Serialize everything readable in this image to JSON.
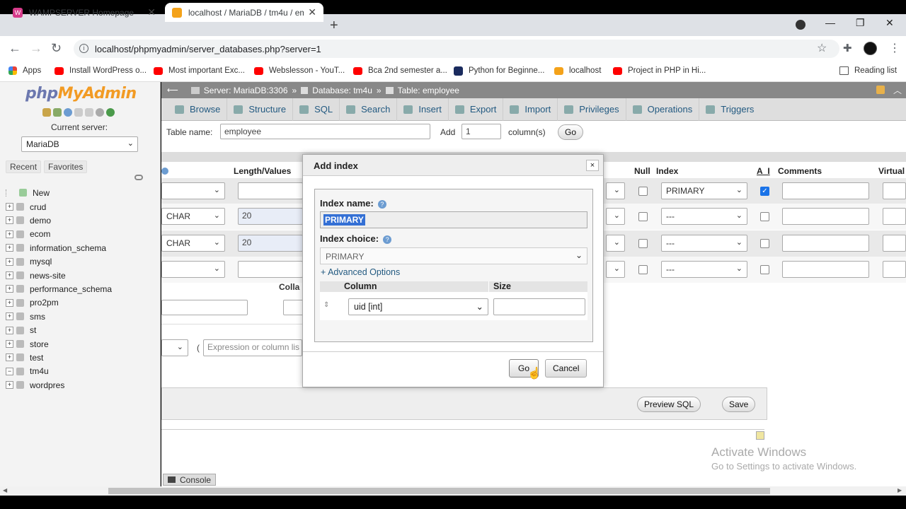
{
  "browser": {
    "tabs": [
      {
        "title": "WAMPSERVER Homepage",
        "active": false
      },
      {
        "title": "localhost / MariaDB / tm4u / em",
        "active": true
      }
    ],
    "url": "localhost/phpmyadmin/server_databases.php?server=1",
    "bookmarks": [
      {
        "label": "Apps",
        "color": "#e94235"
      },
      {
        "label": "Install WordPress o...",
        "color": "#ff0000"
      },
      {
        "label": "Most important Exc...",
        "color": "#ff0000"
      },
      {
        "label": "Webslesson - YouT...",
        "color": "#ff0000"
      },
      {
        "label": "Bca 2nd semester a...",
        "color": "#ff0000"
      },
      {
        "label": "Python for Beginne...",
        "color": "#1a73e8"
      },
      {
        "label": "localhost",
        "color": "#f4a21a"
      },
      {
        "label": "Project in PHP in Hi...",
        "color": "#ff0000"
      }
    ],
    "reading_list": "Reading list"
  },
  "sidebar": {
    "logo_php": "php",
    "logo_myadmin": "MyAdmin",
    "current_server_label": "Current server:",
    "server": "MariaDB",
    "recent": "Recent",
    "favorites": "Favorites",
    "new_label": "New",
    "databases": [
      "crud",
      "demo",
      "ecom",
      "information_schema",
      "mysql",
      "news-site",
      "performance_schema",
      "pro2pm",
      "sms",
      "st",
      "store",
      "test",
      "tm4u",
      "wordpres"
    ]
  },
  "breadcrumb": {
    "server": "Server: MariaDB:3306",
    "database": "Database: tm4u",
    "table": "Table: employee",
    "sep": "»"
  },
  "menu": [
    "Browse",
    "Structure",
    "SQL",
    "Search",
    "Insert",
    "Export",
    "Import",
    "Privileges",
    "Operations",
    "Triggers"
  ],
  "form": {
    "table_name_label": "Table name:",
    "table_name": "employee",
    "add_label": "Add",
    "add_count": "1",
    "columns_label": "column(s)",
    "go": "Go"
  },
  "columns_header": {
    "length": "Length/Values",
    "null": "Null",
    "index": "Index",
    "ai": "A_I",
    "comments": "Comments",
    "virtual": "Virtual"
  },
  "rows": [
    {
      "type": "",
      "length": "",
      "index": "PRIMARY",
      "ai": true
    },
    {
      "type": "CHAR",
      "length": "20",
      "index": "---",
      "ai": false
    },
    {
      "type": "CHAR",
      "length": "20",
      "index": "---",
      "ai": false
    },
    {
      "type": "",
      "length": "",
      "index": "---",
      "ai": false
    }
  ],
  "collation_label": "Colla",
  "expression_placeholder": "Expression or column lis",
  "paren": "(",
  "dialog": {
    "title": "Add index",
    "close": "×",
    "index_name_label": "Index name:",
    "index_name": "PRIMARY",
    "index_choice_label": "Index choice:",
    "index_choice": "PRIMARY",
    "advanced": "+ Advanced Options",
    "column_header": "Column",
    "size_header": "Size",
    "column_value": "uid [int]",
    "go": "Go",
    "cancel": "Cancel"
  },
  "actions": {
    "preview": "Preview SQL",
    "save": "Save"
  },
  "console": "Console",
  "watermark": {
    "line1": "Activate Windows",
    "line2": "Go to Settings to activate Windows."
  }
}
